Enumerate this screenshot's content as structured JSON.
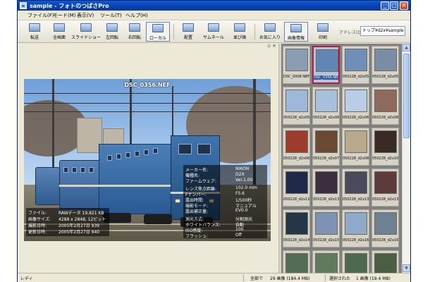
{
  "window": {
    "title": "sample - フォトのつばさPro",
    "min": "_",
    "max": "□",
    "close": "×"
  },
  "menu": [
    "ファイル(F)",
    "モード(M)",
    "表示(V)",
    "ツール(T)",
    "ヘルプ(H)"
  ],
  "toolbar": {
    "buttons": [
      "転送",
      "全画面",
      "スライドショー",
      "左回転",
      "右回転",
      "ローカル",
      "配置",
      "サムネール",
      "並び順",
      "お気に入り",
      "画像情報",
      "印刷"
    ],
    "address_label": "アドレス(D)",
    "address_value": "トップ¥d2x¥sample"
  },
  "viewer": {
    "pane_close": "×",
    "pane_restore": "▫",
    "filename": "DSC_0356.NEF",
    "exif_right": [
      {
        "k": "メーカー名:",
        "v": "NIKON"
      },
      {
        "k": "機種名:",
        "v": "D2X"
      },
      {
        "k": "ファームウェア:",
        "v": "Ver.1.00"
      },
      {
        "k": "レンズ焦点距離:",
        "v": "102.0 mm"
      },
      {
        "k": "Fナンバー:",
        "v": "F5.6"
      },
      {
        "k": "露出時間:",
        "v": "1/500秒"
      },
      {
        "k": "撮影モード:",
        "v": "マニュアル"
      },
      {
        "k": "露出補正量:",
        "v": "EV0.0"
      },
      {
        "k": "測光方式:",
        "v": "分割測光"
      },
      {
        "k": "ホワイトバランス:",
        "v": "自動"
      },
      {
        "k": "ISO感度:",
        "v": "100"
      },
      {
        "k": "フラッシュ:",
        "v": "Off"
      }
    ],
    "exif_left": [
      {
        "k": "ファイル:",
        "v": "RAWデータ 19,821 KB"
      },
      {
        "k": "画像サイズ:",
        "v": "4288 x 2848, 12ビット"
      },
      {
        "k": "撮影日時:",
        "v": "2005年2月27日 939"
      },
      {
        "k": "更新日時:",
        "v": "2005年2月27日 940"
      }
    ]
  },
  "thumbnails": [
    {
      "cap": "DSC_0008.NEF",
      "color": "#8a9db3",
      "selected": false
    },
    {
      "cap": "DSC_0356.NEF",
      "color": "#5f86b5",
      "selected": true
    },
    {
      "cap": "050228_d2x05...",
      "color": "#6f8fb8",
      "selected": false
    },
    {
      "cap": "050228_d2x05...",
      "color": "#7a8da4",
      "selected": false
    },
    {
      "cap": "050228_d2x05...",
      "color": "#9db8d8",
      "selected": false
    },
    {
      "cap": "050228_d2x06...",
      "color": "#a7c1dd",
      "selected": false
    },
    {
      "cap": "050228_d2x06...",
      "color": "#b9cde6",
      "selected": false
    },
    {
      "cap": "050228_d2x06...",
      "color": "#8f6a5a",
      "selected": false
    },
    {
      "cap": "050228_d2x06...",
      "color": "#9c3b2e",
      "selected": false
    },
    {
      "cap": "050228_d2x07...",
      "color": "#6b4a33",
      "selected": false
    },
    {
      "cap": "050228_d2x08...",
      "color": "#b8a88c",
      "selected": false
    },
    {
      "cap": "050228_d2x10...",
      "color": "#3a2a26",
      "selected": false
    },
    {
      "cap": "050228_d2x12...",
      "color": "#1f2a4a",
      "selected": false
    },
    {
      "cap": "050228_d2x13...",
      "color": "#3b2f3e",
      "selected": false
    },
    {
      "cap": "050228_d2x13...",
      "color": "#4a4a5c",
      "selected": false
    },
    {
      "cap": "050228_d2x13...",
      "color": "#5c3b3b",
      "selected": false
    },
    {
      "cap": "050228_d2x14...",
      "color": "#273548",
      "selected": false
    },
    {
      "cap": "050228_d2x15...",
      "color": "#7e93b3",
      "selected": false
    },
    {
      "cap": "050228_d2x16...",
      "color": "#8faac9",
      "selected": false
    },
    {
      "cap": "050228_d2x16...",
      "color": "#6f8094",
      "selected": false
    },
    {
      "cap": "050228_d2x17...",
      "color": "#556b55",
      "selected": false
    },
    {
      "cap": "050228_d2x17...",
      "color": "#5f7a5f",
      "selected": false
    },
    {
      "cap": "050228_d2x17...",
      "color": "#4e6a4e",
      "selected": false
    },
    {
      "cap": "050228_d2x17...",
      "color": "#4a5e44",
      "selected": false
    }
  ],
  "status": {
    "ready": "レディ",
    "total_label": "全部で",
    "total_value": "29 画像 (184.4 MB)",
    "selected_label": "選択された",
    "selected_value": "1 画像 (19.4 MB)"
  }
}
